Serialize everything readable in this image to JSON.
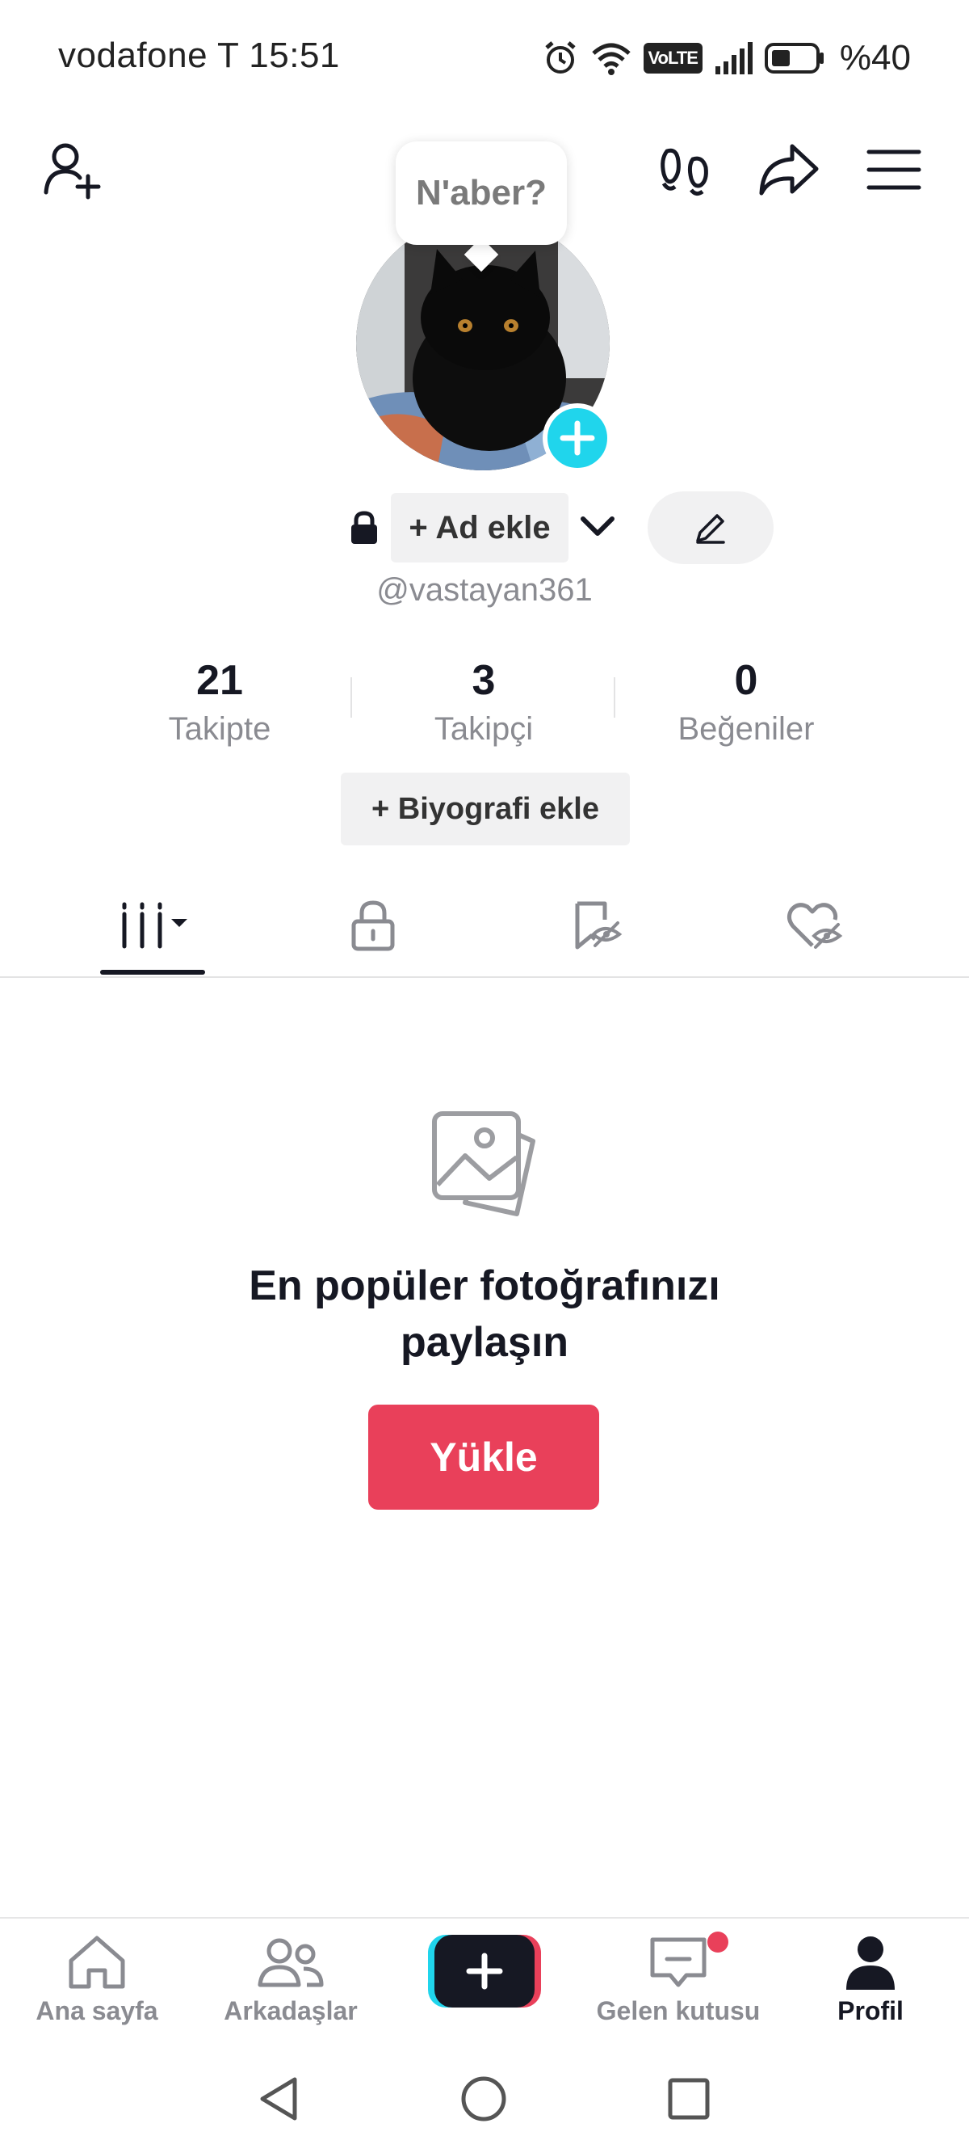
{
  "status_bar": {
    "carrier": "vodafone T",
    "time": "15:51",
    "volte": "VoLTE",
    "battery": "%40"
  },
  "profile": {
    "tooltip": "N'aber?",
    "add_name_label": "+ Ad ekle",
    "username": "@vastayan361",
    "stats": [
      {
        "value": "21",
        "label": "Takipte"
      },
      {
        "value": "3",
        "label": "Takipçi"
      },
      {
        "value": "0",
        "label": "Beğeniler"
      }
    ],
    "bio_button": "+ Biyografi ekle"
  },
  "empty_state": {
    "title_line1": "En popüler fotoğrafınızı",
    "title_line2": "paylaşın",
    "upload_button": "Yükle"
  },
  "bottom_nav": {
    "items": [
      {
        "label": "Ana sayfa",
        "icon": "home-icon"
      },
      {
        "label": "Arkadaşlar",
        "icon": "friends-icon"
      },
      {
        "label": "",
        "icon": "create-plus-icon"
      },
      {
        "label": "Gelen kutusu",
        "icon": "inbox-icon"
      },
      {
        "label": "Profil",
        "icon": "profile-icon"
      }
    ],
    "active": "Profil"
  },
  "colors": {
    "accent_red": "#e9405a",
    "accent_cyan": "#20d5ec",
    "text_primary": "#161823",
    "text_secondary": "#8a8b91"
  }
}
